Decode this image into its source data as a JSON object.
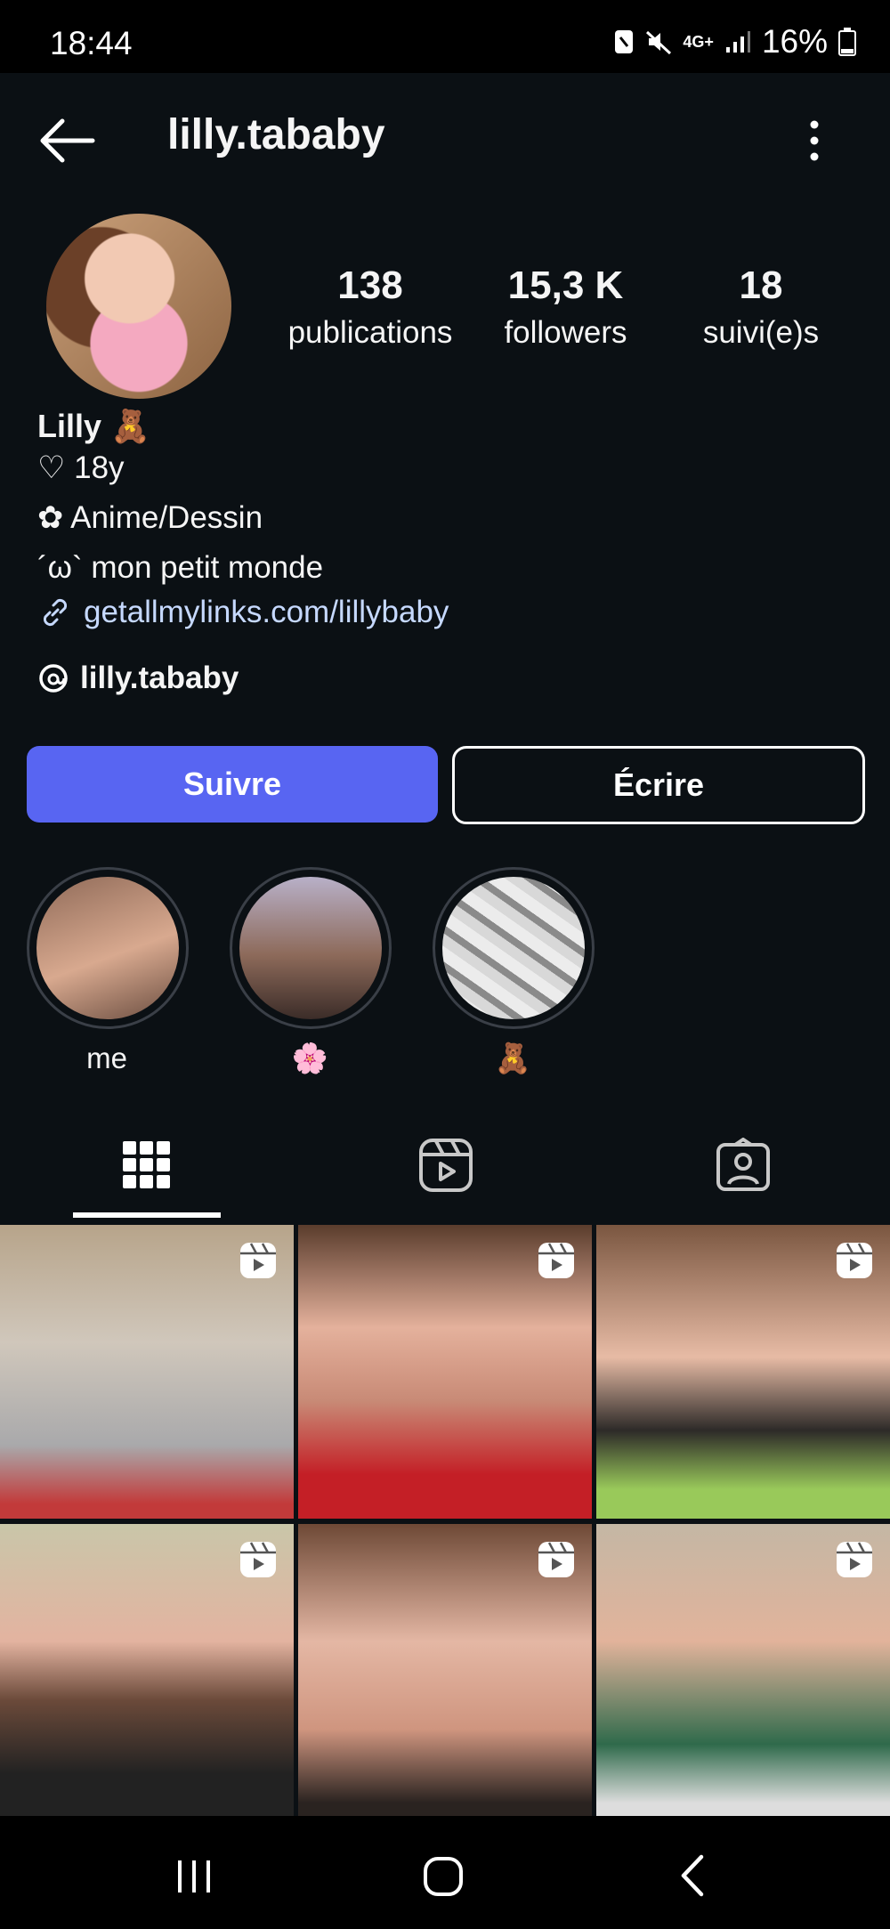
{
  "status_bar": {
    "time": "18:44",
    "network": "4G+",
    "battery": "16%"
  },
  "header": {
    "username": "lilly.tababy"
  },
  "stats": [
    {
      "value": "138",
      "label": "publications"
    },
    {
      "value": "15,3 K",
      "label": "followers"
    },
    {
      "value": "18",
      "label": "suivi(e)s"
    }
  ],
  "bio": {
    "name": "Lilly 🧸",
    "line1": "♡ 18y",
    "line2": "✿ Anime/Dessin",
    "line3": "´ω` mon petit monde",
    "link": "getallmylinks.com/lillybaby",
    "threads": "lilly.tababy"
  },
  "buttons": {
    "follow": "Suivre",
    "message": "Écrire"
  },
  "highlights": [
    {
      "label": "me"
    },
    {
      "label": "🌸"
    },
    {
      "label": "🧸"
    }
  ],
  "colors": {
    "background": "#0b1014",
    "follow_button": "#5865f2",
    "link": "#c6d9ff"
  },
  "icons": {
    "back": "back-arrow-icon",
    "more": "more-vertical-icon",
    "grid": "grid-icon",
    "reels": "reels-icon",
    "tagged": "tagged-icon",
    "reel_badge": "reel-icon"
  }
}
